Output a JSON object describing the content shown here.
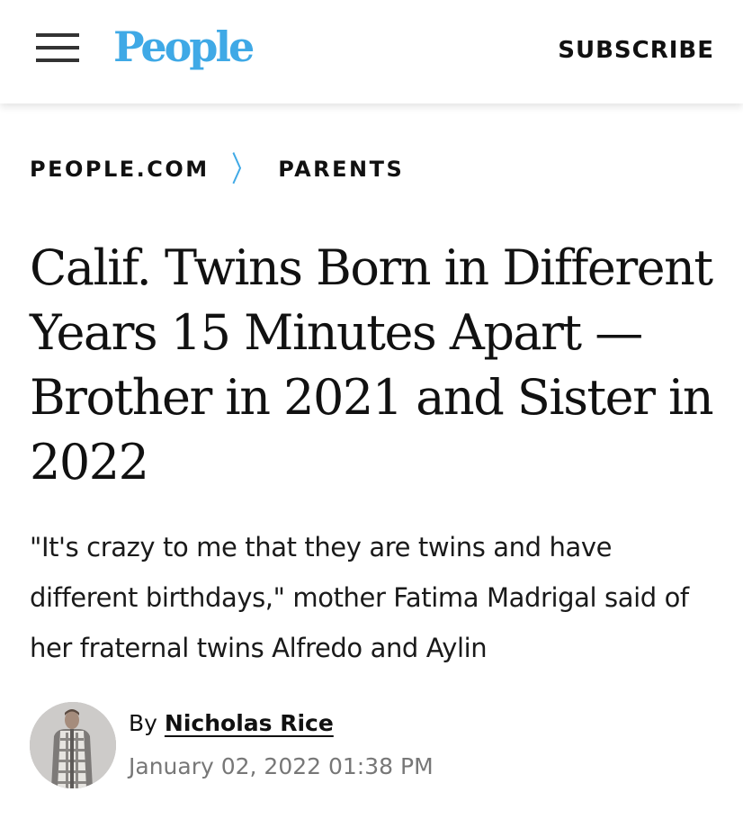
{
  "header": {
    "logo_text": "People",
    "subscribe_label": "SUBSCRIBE"
  },
  "breadcrumb": [
    {
      "label": "PEOPLE.COM"
    },
    {
      "label": "PARENTS"
    }
  ],
  "article": {
    "title": "Calif. Twins Born in Different Years 15 Minutes Apart — Brother in 2021 and Sister in 2022",
    "dek": "\"It's crazy to me that they are twins and have different birthdays,\" mother Fatima Madrigal said of her fraternal twins Alfredo and Aylin",
    "byline_prefix": "By",
    "author": "Nicholas Rice",
    "date": "January 02, 2022 01:38 PM"
  },
  "colors": {
    "brand": "#3fa9e6",
    "text": "#111111",
    "meta": "#777777"
  },
  "icons": {
    "menu": "hamburger-menu-icon",
    "breadcrumb_separator": "chevron-right-icon"
  }
}
